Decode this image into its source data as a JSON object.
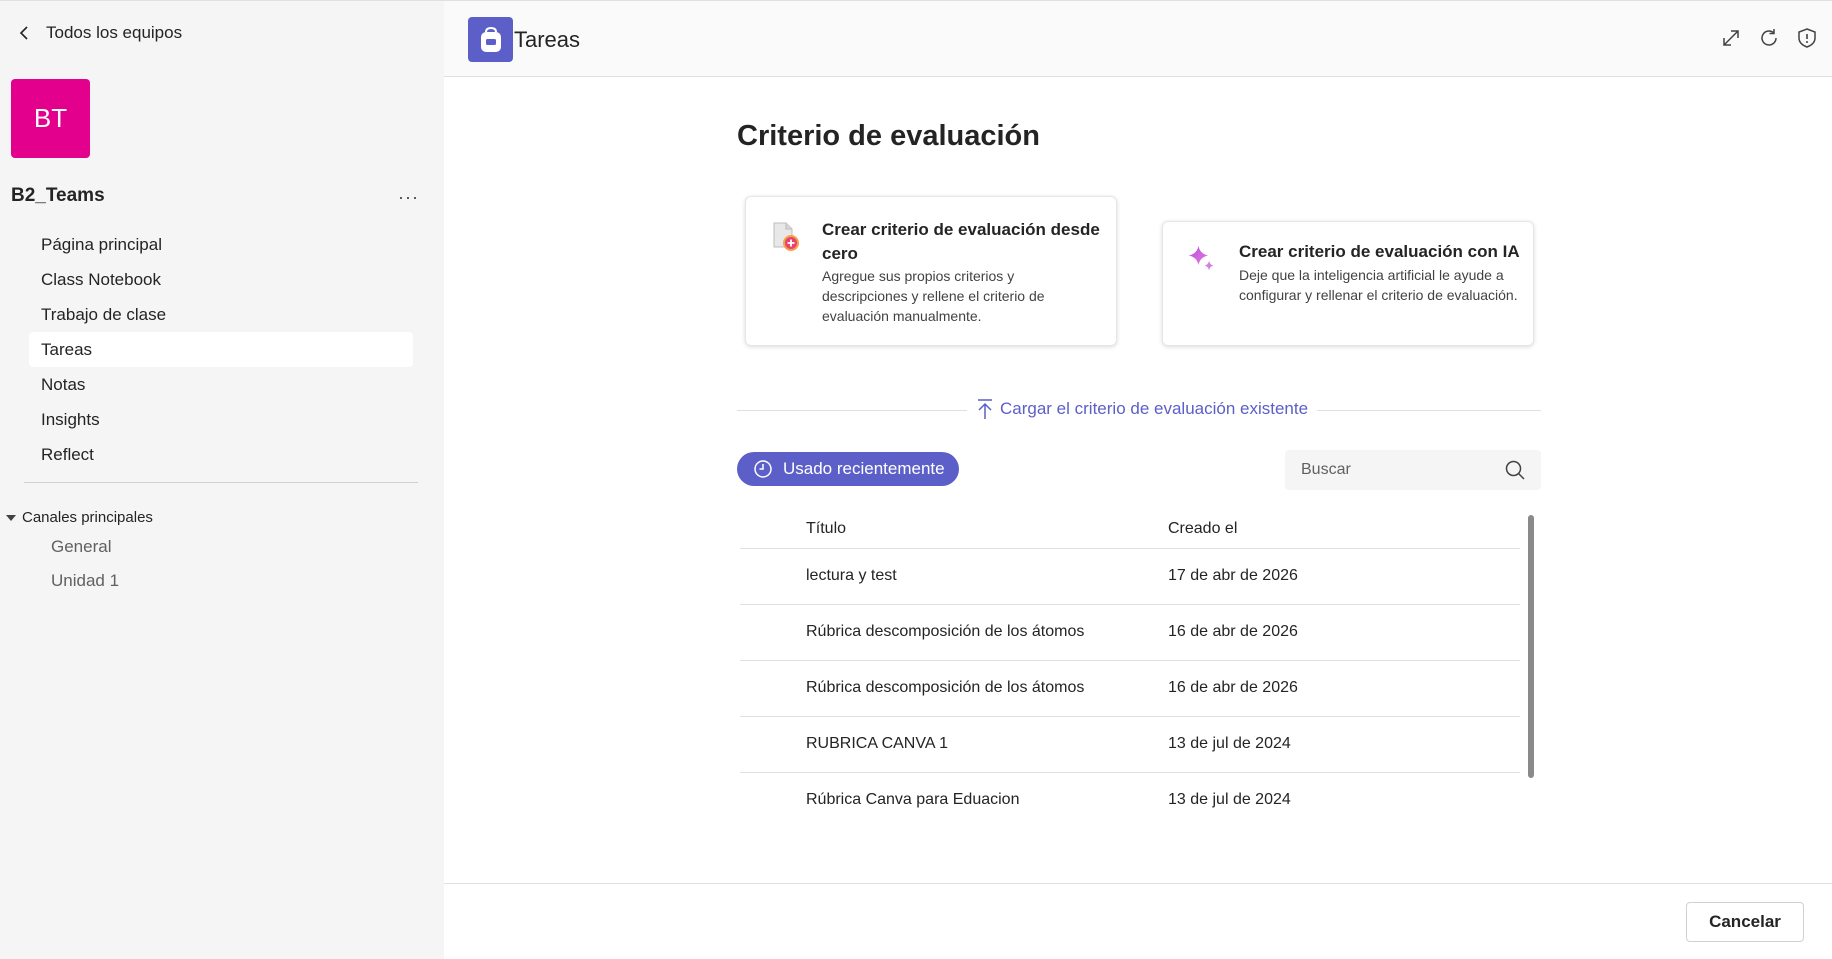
{
  "sidebar": {
    "back_label": "Todos los equipos",
    "avatar_initials": "BT",
    "avatar_color": "#e3008c",
    "team_name": "B2_Teams",
    "more_label": "···",
    "items": [
      {
        "label": "Página principal"
      },
      {
        "label": "Class Notebook"
      },
      {
        "label": "Trabajo de clase"
      },
      {
        "label": "Tareas",
        "active": true
      },
      {
        "label": "Notas"
      },
      {
        "label": "Insights"
      },
      {
        "label": "Reflect"
      }
    ],
    "channels_label": "Canales principales",
    "channels": [
      "General",
      "Unidad 1"
    ]
  },
  "header": {
    "app_title": "Tareas",
    "accent": "#5b5fc7",
    "icons": [
      "expand-icon",
      "refresh-icon",
      "shield-icon"
    ]
  },
  "main": {
    "title": "Criterio de evaluación",
    "cards": [
      {
        "title": "Crear criterio de evaluación desde cero",
        "desc": "Agregue sus propios criterios y descripciones y rellene el criterio de evaluación manualmente.",
        "icon": "document-plus-icon"
      },
      {
        "title": "Crear criterio de evaluación con IA",
        "desc": "Deje que la inteligencia artificial le ayude a configurar y rellenar el criterio de evaluación.",
        "icon": "sparkle-icon"
      }
    ],
    "upload_label": "Cargar el criterio de evaluación existente",
    "recent_label": "Usado recientemente",
    "search_placeholder": "Buscar",
    "table": {
      "headers": [
        "Título",
        "Creado el"
      ],
      "rows": [
        [
          "lectura y test",
          "17 de abr de 2026"
        ],
        [
          "Rúbrica descomposición de los átomos",
          "16 de abr de 2026"
        ],
        [
          "Rúbrica descomposición de los átomos",
          "16 de abr de 2026"
        ],
        [
          "RUBRICA CANVA 1",
          "13 de jul de 2024"
        ],
        [
          "Rúbrica Canva para Eduacion",
          "13 de jul de 2024"
        ]
      ]
    }
  },
  "footer": {
    "cancel_label": "Cancelar"
  }
}
